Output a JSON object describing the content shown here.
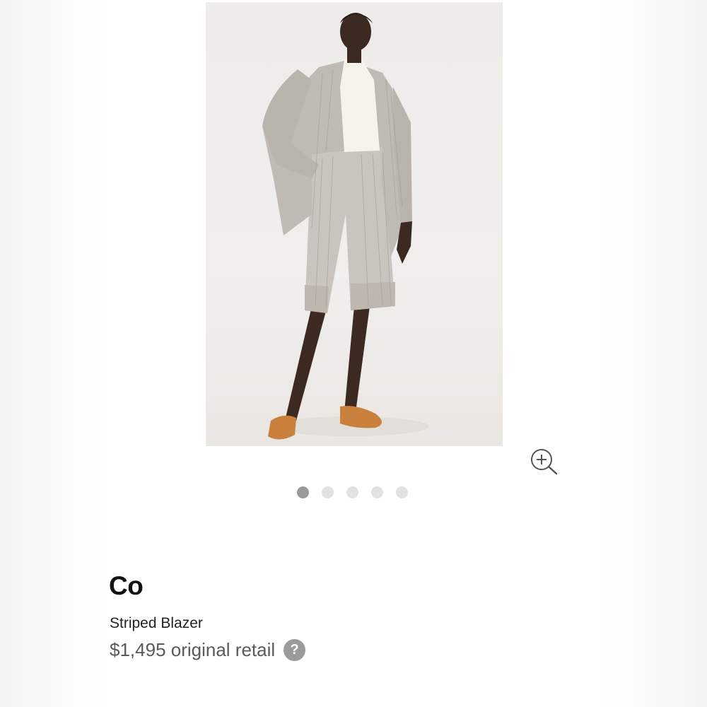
{
  "product": {
    "brand": "Co",
    "name": "Striped Blazer",
    "price": "$1,495 original retail",
    "help_glyph": "?"
  },
  "gallery": {
    "image_count": 5,
    "active_index": 0,
    "zoom_icon": "zoom-in-icon"
  },
  "colors": {
    "dot_active": "#9a9a9a",
    "dot_inactive": "#e2e2e2",
    "help_icon": "#9b9b9b"
  }
}
